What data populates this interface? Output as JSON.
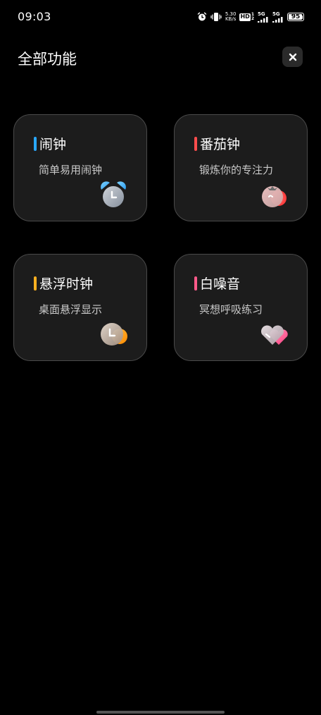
{
  "status": {
    "time": "09:03",
    "net_speed": "5.30",
    "net_unit": "KB/s",
    "hd": "HD",
    "hd_sup": "1",
    "hd_sub": "2",
    "sig1": "5G",
    "sig2": "5G",
    "battery": "95",
    "battery_level": 0.95
  },
  "header": {
    "title": "全部功能"
  },
  "cards": [
    {
      "title": "闹钟",
      "subtitle": "简单易用闹钟",
      "accent": "#29a8ff",
      "icon": "alarm-clock-icon"
    },
    {
      "title": "番茄钟",
      "subtitle": "锻炼你的专注力",
      "accent": "#ff4d4d",
      "icon": "tomato-icon"
    },
    {
      "title": "悬浮时钟",
      "subtitle": "桌面悬浮显示",
      "accent": "#ffb020",
      "icon": "floating-clock-icon"
    },
    {
      "title": "白噪音",
      "subtitle": "冥想呼吸练习",
      "accent": "#ff5a8a",
      "icon": "heart-icon"
    }
  ]
}
